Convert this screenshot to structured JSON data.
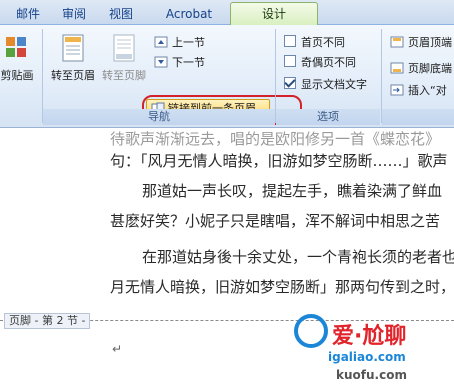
{
  "tabs": [
    {
      "label": "邮件",
      "active": false
    },
    {
      "label": "审阅",
      "active": false
    },
    {
      "label": "视图",
      "active": false
    },
    {
      "label": "Acrobat",
      "active": false
    },
    {
      "label": "设计",
      "active": true
    }
  ],
  "ribbon": {
    "clip_label": "剪贴画",
    "goto_header": "转至页眉",
    "goto_footer": "转至页脚",
    "prev_section": "上一节",
    "next_section": "下一节",
    "link_previous": "链接到前一条页眉",
    "nav_group": "导航",
    "options_group": "选项",
    "opt_first_page": "首页不同",
    "opt_odd_even": "奇偶页不同",
    "opt_show_text": "显示文档文字",
    "right_btn1": "页眉顶端",
    "right_btn2": "页脚底端",
    "right_btn3": "插入“对"
  },
  "document": {
    "lines": [
      "待歌声渐渐远去，唱的是欧阳修另一首《蝶恋花》",
      "句：「风月无情人暗换，旧游如梦空肠断……」歌声",
      "那道姑一声长叹，提起左手，瞧着染满了鲜血",
      "甚麽好笑？小妮子只是瞎唱，浑不解词中相思之苦",
      "在那道姑身後十余丈处，一个青袍长须的老者也",
      "月无情人暗换，旧游如梦空肠断」那两句传到之时，"
    ],
    "footer_label": "页脚 - 第 2 节 -",
    "para_mark": "↵"
  },
  "watermark": {
    "text1": "爱·尬聊",
    "text2": "igaliao.com",
    "text3": "kuofu.com"
  }
}
